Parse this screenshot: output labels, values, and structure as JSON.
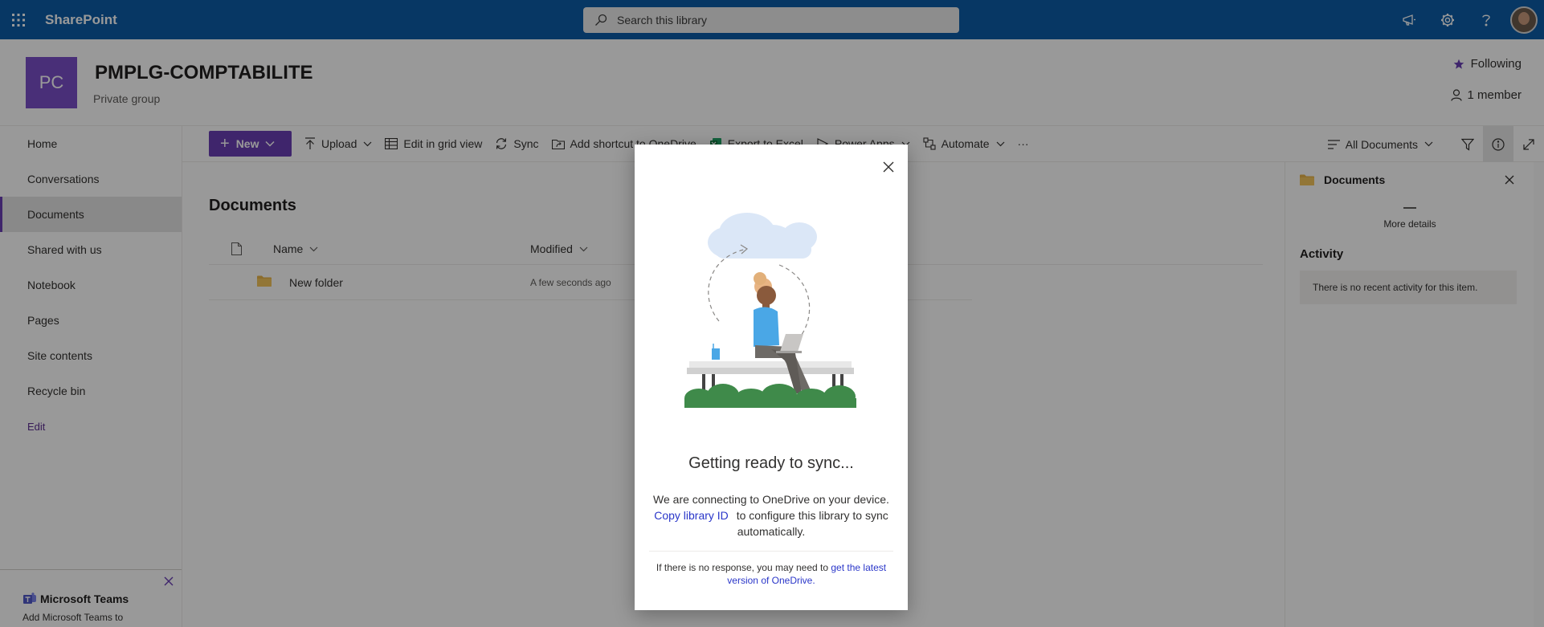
{
  "suite": {
    "app_name": "SharePoint",
    "search_placeholder": "Search this library"
  },
  "site": {
    "logo_initials": "PC",
    "title": "PMPLG-COMPTABILITE",
    "subtitle": "Private group",
    "follow_label": "Following",
    "members_label": "1 member",
    "logo_color": "#7b4fc9"
  },
  "nav": {
    "items": [
      {
        "label": "Home"
      },
      {
        "label": "Conversations"
      },
      {
        "label": "Documents"
      },
      {
        "label": "Shared with us"
      },
      {
        "label": "Notebook"
      },
      {
        "label": "Pages"
      },
      {
        "label": "Site contents"
      },
      {
        "label": "Recycle bin"
      }
    ],
    "edit_label": "Edit",
    "active_item": "Documents"
  },
  "teams_promo": {
    "title": "Microsoft Teams",
    "subtitle": "Add Microsoft Teams to"
  },
  "commands": {
    "new_label": "New",
    "upload_label": "Upload",
    "grid_label": "Edit in grid view",
    "sync_label": "Sync",
    "shortcut_label": "Add shortcut to OneDrive",
    "export_label": "Export to Excel",
    "powerapps_label": "Power Apps",
    "automate_label": "Automate",
    "more_label": "···",
    "view_label": "All Documents"
  },
  "library": {
    "title": "Documents",
    "columns": {
      "name": "Name",
      "modified": "Modified"
    },
    "rows": [
      {
        "name": "New folder",
        "modified": "A few seconds ago"
      }
    ]
  },
  "details": {
    "title": "Documents",
    "more_details": "More details",
    "activity_heading": "Activity",
    "empty_activity": "There is no recent activity for this item."
  },
  "dialog": {
    "title": "Getting ready to sync...",
    "body_before": "We are connecting to OneDrive on your device.",
    "copy_link": "Copy library ID",
    "body_after": "to configure this library to sync automatically.",
    "footer_before": "If there is no response, you may need to",
    "footer_link": "get the latest version of OneDrive."
  },
  "colors": {
    "suite_bar": "#0c5ca7",
    "accent": "#6a3fb5",
    "link": "#2a36c9"
  }
}
